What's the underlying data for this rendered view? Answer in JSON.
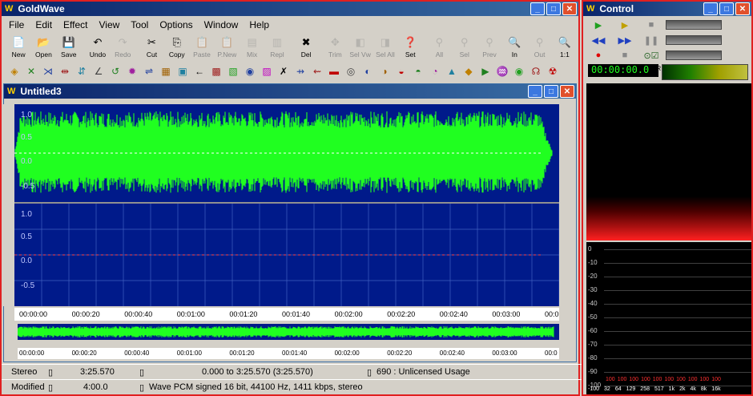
{
  "app": {
    "title": "GoldWave"
  },
  "menu": [
    "File",
    "Edit",
    "Effect",
    "View",
    "Tool",
    "Options",
    "Window",
    "Help"
  ],
  "toolbar1": [
    {
      "label": "New",
      "icon": "new-icon",
      "enabled": true
    },
    {
      "label": "Open",
      "icon": "open-icon",
      "enabled": true
    },
    {
      "label": "Save",
      "icon": "save-icon",
      "enabled": true
    },
    {
      "label": "Undo",
      "icon": "undo-icon",
      "enabled": true
    },
    {
      "label": "Redo",
      "icon": "redo-icon",
      "enabled": false
    },
    {
      "label": "Cut",
      "icon": "cut-icon",
      "enabled": true
    },
    {
      "label": "Copy",
      "icon": "copy-icon",
      "enabled": true
    },
    {
      "label": "Paste",
      "icon": "paste-icon",
      "enabled": false
    },
    {
      "label": "P.New",
      "icon": "paste-new-icon",
      "enabled": false
    },
    {
      "label": "Mix",
      "icon": "mix-icon",
      "enabled": false
    },
    {
      "label": "Repl",
      "icon": "replace-icon",
      "enabled": false
    },
    {
      "label": "Del",
      "icon": "delete-icon",
      "enabled": true
    },
    {
      "label": "Trim",
      "icon": "trim-icon",
      "enabled": false
    },
    {
      "label": "Sel Vw",
      "icon": "select-view-icon",
      "enabled": false
    },
    {
      "label": "Sel All",
      "icon": "select-all-icon",
      "enabled": false
    },
    {
      "label": "Set",
      "icon": "set-icon",
      "enabled": true
    },
    {
      "label": "All",
      "icon": "zoom-all-icon",
      "enabled": false
    },
    {
      "label": "Sel",
      "icon": "zoom-sel-icon",
      "enabled": false
    },
    {
      "label": "Prev",
      "icon": "zoom-prev-icon",
      "enabled": false
    },
    {
      "label": "In",
      "icon": "zoom-in-icon",
      "enabled": true
    },
    {
      "label": "Out",
      "icon": "zoom-out-icon",
      "enabled": false
    },
    {
      "label": "1:1",
      "icon": "zoom-1to1-icon",
      "enabled": true
    }
  ],
  "document": {
    "title": "Untitled3",
    "y_labels_top": [
      "1.0",
      "0.5",
      "0.0",
      "-0.5"
    ],
    "y_labels_bottom": [
      "1.0",
      "0.5",
      "0.0",
      "-0.5"
    ],
    "time_ticks": [
      "00:00:00",
      "00:00:20",
      "00:00:40",
      "00:01:00",
      "00:01:20",
      "00:01:40",
      "00:02:00",
      "00:02:20",
      "00:02:40",
      "00:03:00",
      "00:0"
    ],
    "overview_ticks": [
      "00:00:00",
      "00:00:20",
      "00:00:40",
      "00:01:00",
      "00:01:20",
      "00:01:40",
      "00:02:00",
      "00:02:20",
      "00:02:40",
      "00:03:00",
      "00:0"
    ]
  },
  "status": {
    "channels": "Stereo",
    "length": "3:25.570",
    "selection": "0.000 to 3:25.570 (3:25.570)",
    "license": "690 : Unlicensed Usage",
    "state": "Modified",
    "position": "4:00.0",
    "format": "Wave PCM signed 16 bit, 44100 Hz, 1411 kbps, stereo"
  },
  "control": {
    "title": "Control",
    "time": "00:00:00.0",
    "lr_label": "L R",
    "eq_labels": [
      "0",
      "-10",
      "-20",
      "-30",
      "-40",
      "-50",
      "-60",
      "-70",
      "-80",
      "-90",
      "-100"
    ],
    "freq_labels": [
      "32",
      "64",
      "129",
      "258",
      "517",
      "1k",
      "2k",
      "4k",
      "8k",
      "16k"
    ],
    "peak_labels": [
      "100",
      "100",
      "100",
      "100",
      "100",
      "100",
      "100",
      "100",
      "100",
      "100"
    ]
  },
  "colors": {
    "waveform": "#20ff20",
    "background": "#001a8a",
    "accent": "#0a246a",
    "peak": "#ff2020"
  }
}
